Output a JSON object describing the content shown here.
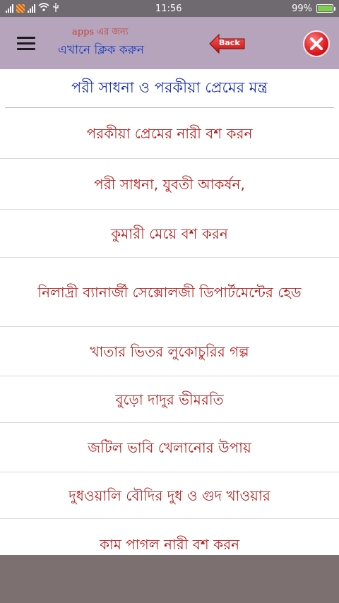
{
  "status_bar": {
    "signal_text": ".ıll",
    "signal_text2": ".ıll",
    "time": "11:56",
    "battery": "99%",
    "battery_level": 0.99
  },
  "appbar": {
    "promo_top": "apps এর জন্য",
    "promo_bottom": "এখানে ক্লিক করুন",
    "back_label": "Back"
  },
  "list": {
    "header": "পরী সাধনা ও পরকীয়া প্রেমের মন্ত্র",
    "items": [
      "পরকীয়া প্রেমের নারী বশ করন",
      "পরী সাধনা, যুবতী আকর্ষন,",
      "কুমারী মেয়ে বশ করন",
      "নিলাদ্রী ব্যানার্জী সেক্সোলজী ডিপার্টমেন্টের হেড",
      "খাতার ভিতর লুকোচুরির গল্প",
      "বুড়ো দাদুর ভীমরতি",
      "জটিল ভাবি খেলানোর উপায়",
      "দুধওয়ালি বৌদির দুধ ও গুদ খাওয়ার",
      "কাম পাগল নারী বশ করন"
    ]
  },
  "colors": {
    "appbar": "#b6a3bc",
    "header_text": "#1a2fb0",
    "item_text": "#b42020",
    "footer": "#7d7070"
  }
}
